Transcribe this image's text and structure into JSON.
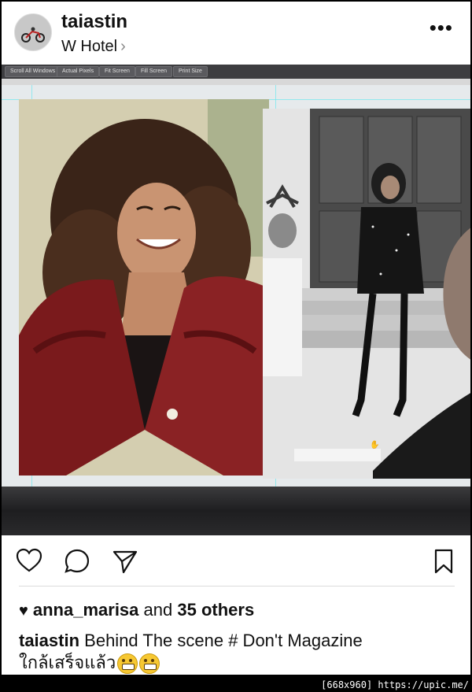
{
  "post": {
    "username": "taiastin",
    "location": "W Hotel",
    "location_chevron": "›",
    "more": "•••"
  },
  "photo_toolbar": {
    "buttons": [
      "Scroll All Windows",
      "Actual Pixels",
      "Fit Screen",
      "Fill Screen",
      "Print Size"
    ]
  },
  "likes": {
    "user": "anna_marisa",
    "joiner": "and",
    "others": "35 others"
  },
  "caption": {
    "username": "taiastin",
    "text": "Behind The scene # Don't Magazine",
    "line2": "ใกล้เสร็จแล้ว"
  },
  "watermark": "[668x960] https://upic.me/",
  "icons": [
    "heart-icon",
    "comment-icon",
    "share-icon",
    "bookmark-icon",
    "more-icon"
  ],
  "colors": {
    "accent": "#111111",
    "divider": "#dbdbdb"
  }
}
